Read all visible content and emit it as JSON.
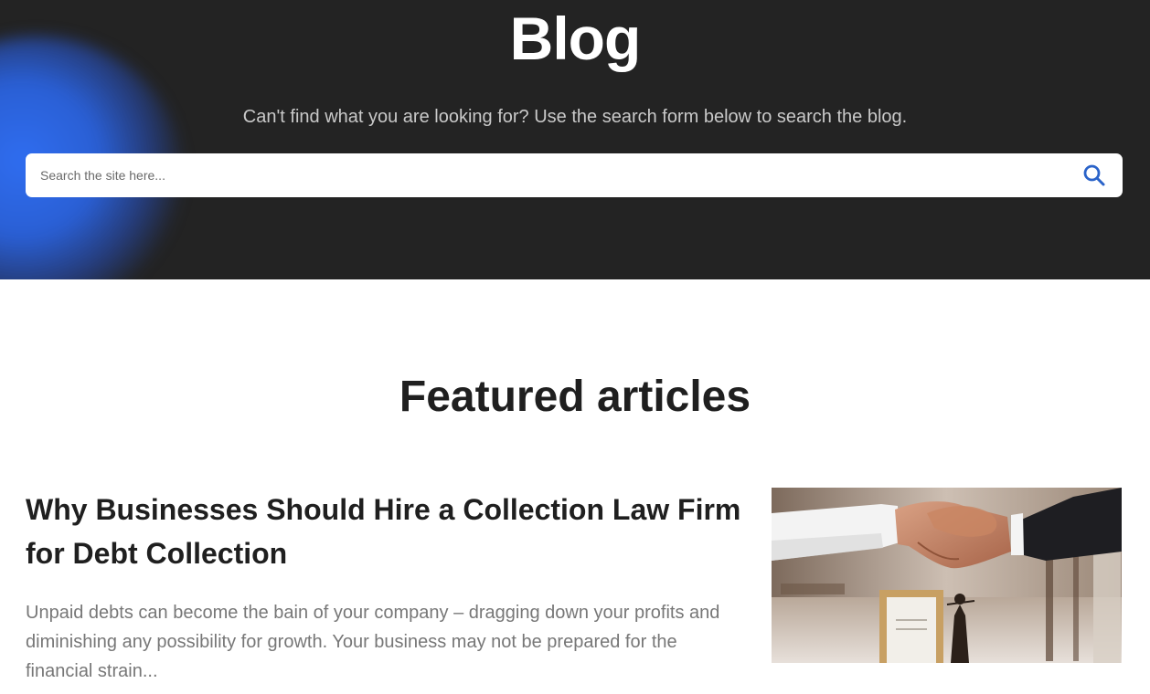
{
  "hero": {
    "title": "Blog",
    "subtitle": "Can't find what you are looking for? Use the search form below to search the blog.",
    "search": {
      "placeholder": "Search the site here...",
      "value": "",
      "icon": "search-icon"
    }
  },
  "featured": {
    "heading": "Featured articles",
    "articles": [
      {
        "title": "Why Businesses Should Hire a Collection Law Firm for Debt Collection",
        "excerpt": "Unpaid debts can become the bain of your company – dragging down your profits and diminishing any possibility for growth. Your business may not be prepared for the financial strain...",
        "image": "handshake-photo"
      }
    ]
  },
  "colors": {
    "hero_background": "#232323",
    "accent": "#2a63c9",
    "glow": "#2f6df0"
  }
}
